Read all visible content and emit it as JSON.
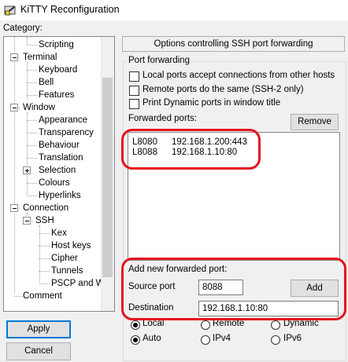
{
  "window": {
    "title": "KiTTY Reconfiguration"
  },
  "category": {
    "label": "Category:",
    "items": [
      {
        "label": "Scripting"
      },
      {
        "label": "Terminal"
      },
      {
        "label": "Keyboard"
      },
      {
        "label": "Bell"
      },
      {
        "label": "Features"
      },
      {
        "label": "Window"
      },
      {
        "label": "Appearance"
      },
      {
        "label": "Transparency"
      },
      {
        "label": "Behaviour"
      },
      {
        "label": "Translation"
      },
      {
        "label": "Selection"
      },
      {
        "label": "Colours"
      },
      {
        "label": "Hyperlinks"
      },
      {
        "label": "Connection"
      },
      {
        "label": "SSH"
      },
      {
        "label": "Kex"
      },
      {
        "label": "Host keys"
      },
      {
        "label": "Cipher"
      },
      {
        "label": "Tunnels"
      },
      {
        "label": "PSCP and W"
      },
      {
        "label": "Comment"
      }
    ]
  },
  "buttons": {
    "apply": "Apply",
    "cancel": "Cancel",
    "remove": "Remove",
    "add": "Add"
  },
  "panel": {
    "header": "Options controlling SSH port forwarding",
    "port_forwarding_label": "Port forwarding",
    "options": [
      {
        "label": "Local ports accept connections from other hosts",
        "checked": false
      },
      {
        "label": "Remote ports do the same (SSH-2 only)",
        "checked": false
      },
      {
        "label": "Print Dynamic ports in window title",
        "checked": false
      }
    ],
    "forwarded_ports_label": "Forwarded ports:",
    "forwarded_ports": [
      {
        "port": "L8080",
        "destination": "192.168.1.200:443"
      },
      {
        "port": "L8088",
        "destination": "192.168.1.10:80"
      }
    ],
    "add_new": {
      "label": "Add new forwarded port:",
      "source_port_label": "Source port",
      "source_port_value": "8088",
      "destination_label": "Destination",
      "destination_value": "192.168.1.10:80",
      "direction": {
        "local": "Local",
        "remote": "Remote",
        "dynamic": "Dynamic",
        "selected": "Local"
      },
      "ipver": {
        "auto": "Auto",
        "ipv4": "IPv4",
        "ipv6": "IPv6",
        "selected": "Auto"
      }
    }
  },
  "colors": {
    "annotation": "#e4131c",
    "focus_border": "#0078d7"
  }
}
